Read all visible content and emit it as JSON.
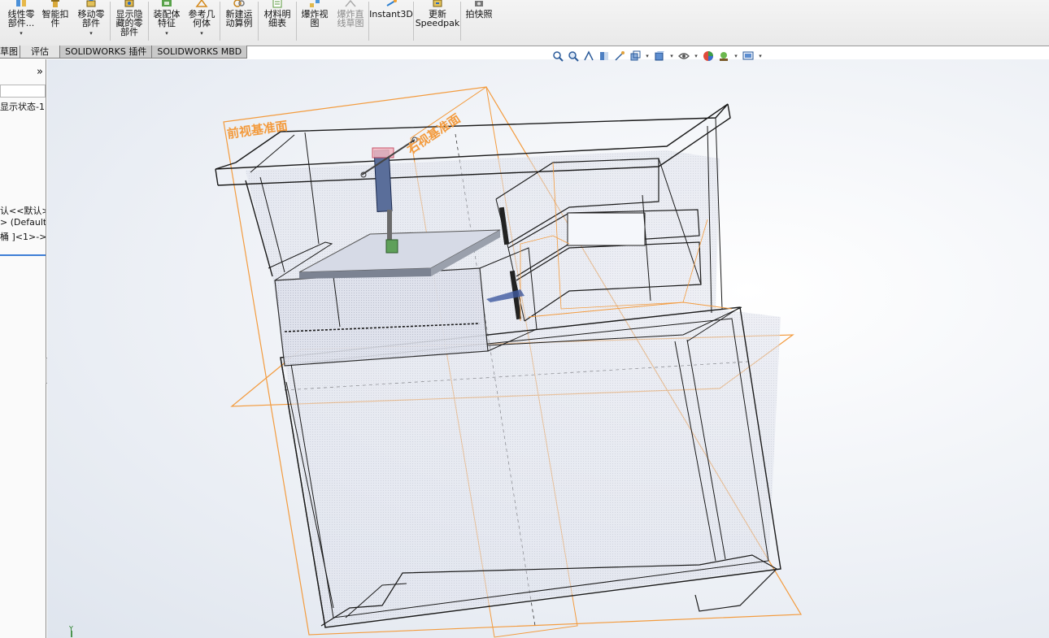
{
  "ribbon": {
    "buttons": [
      {
        "label": "线性零\n部件...",
        "icon": "linear-pattern-icon",
        "dropdown": true
      },
      {
        "label": "智能扣\n件",
        "icon": "smart-fasteners-icon",
        "dropdown": false
      },
      {
        "label": "移动零\n部件",
        "icon": "move-component-icon",
        "dropdown": true
      },
      {
        "label": "显示隐\n藏的零\n部件",
        "icon": "show-hidden-components-icon",
        "dropdown": false
      },
      {
        "label": "装配体\n特征",
        "icon": "assembly-features-icon",
        "dropdown": true
      },
      {
        "label": "参考几\n何体",
        "icon": "reference-geometry-icon",
        "dropdown": true
      },
      {
        "label": "新建运\n动算例",
        "icon": "new-motion-study-icon",
        "dropdown": false
      },
      {
        "label": "材料明\n细表",
        "icon": "bill-of-materials-icon",
        "dropdown": false
      },
      {
        "label": "爆炸视\n图",
        "icon": "exploded-view-icon",
        "dropdown": false
      },
      {
        "label": "爆炸直\n线草图",
        "icon": "explode-line-sketch-icon",
        "dropdown": false,
        "disabled": true
      },
      {
        "label": "Instant3D",
        "icon": "instant3d-icon",
        "dropdown": false
      },
      {
        "label": "更新\nSpeedpak",
        "icon": "update-speedpak-icon",
        "dropdown": false
      },
      {
        "label": "拍快照",
        "icon": "take-snapshot-icon",
        "dropdown": false
      }
    ]
  },
  "tabs": [
    "草图",
    "评估",
    "SOLIDWORKS 插件",
    "SOLIDWORKS MBD"
  ],
  "left_pane": {
    "expand_glyph": "»",
    "display_state": "显示状态-1",
    "tree_items": [
      "认<<默认>",
      "> (Default",
      "桶 ]<1>->"
    ]
  },
  "viewport": {
    "plane_labels": {
      "front": "前视基准面",
      "right": "右视基准面"
    },
    "triad_label": "Y"
  },
  "colors": {
    "plane": "#f39b3e",
    "edge": "#1a1a1a",
    "accent": "#3d7ed6"
  }
}
